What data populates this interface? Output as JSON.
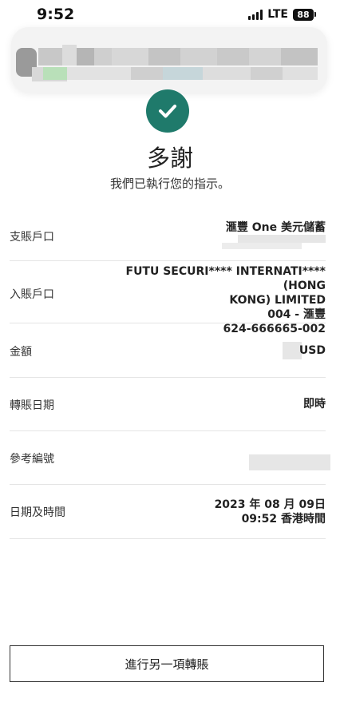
{
  "status": {
    "time": "9:52",
    "network": "LTE",
    "battery": "88"
  },
  "confirmation": {
    "title": "多謝",
    "message": "我們已執行您的指示。"
  },
  "details": {
    "from_account": {
      "label": "支賬戶口",
      "value": "滙豐 One 美元儲蓄"
    },
    "to_account": {
      "label": "入賬戶口",
      "line1": "FUTU SECURI**** INTERNATI**** (HONG",
      "line2": "KONG) LIMITED",
      "line3": "004 - 滙豐",
      "line4": "624-666665-002"
    },
    "amount": {
      "label": "金額",
      "currency": "USD"
    },
    "transfer_date": {
      "label": "轉賬日期",
      "value": "即時"
    },
    "reference": {
      "label": "參考編號"
    },
    "datetime": {
      "label": "日期及時間",
      "line1": "2023 年 08 月 09日",
      "line2": "09:52 香港時間"
    }
  },
  "actions": {
    "another_transfer": "進行另一項轉賬"
  }
}
